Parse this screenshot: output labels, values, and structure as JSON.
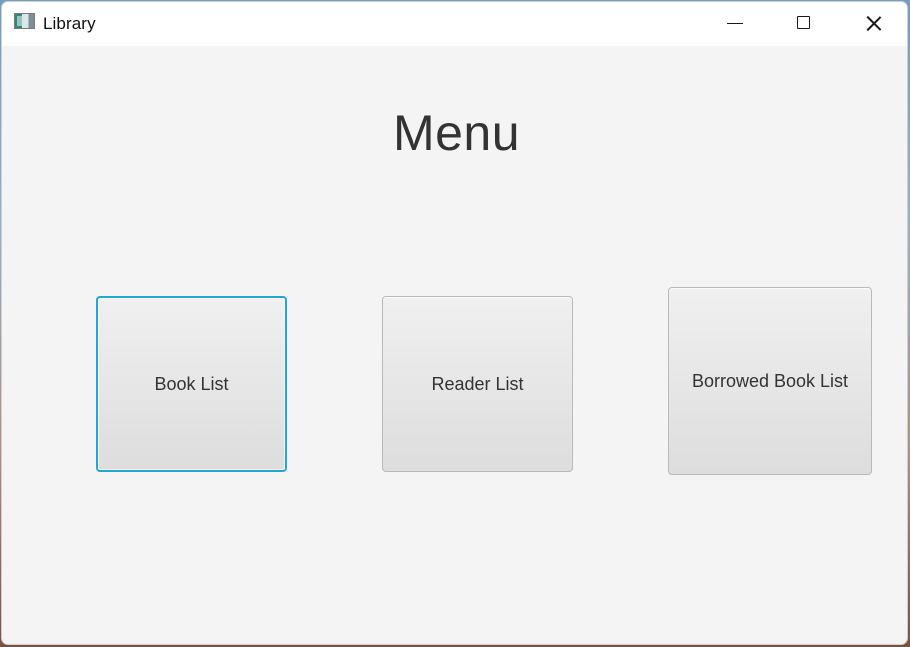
{
  "window": {
    "title": "Library",
    "controls": {
      "minimize_icon": "minimize-icon",
      "maximize_icon": "maximize-icon",
      "close_icon": "close-icon"
    }
  },
  "menu": {
    "title": "Menu",
    "buttons": [
      {
        "label": "Book List",
        "focused": true
      },
      {
        "label": "Reader List",
        "focused": false
      },
      {
        "label": "Borrowed Book List",
        "focused": false
      }
    ]
  },
  "colors": {
    "window_background": "#f4f4f4",
    "button_focus": "#21a7d7",
    "text": "#333333"
  }
}
